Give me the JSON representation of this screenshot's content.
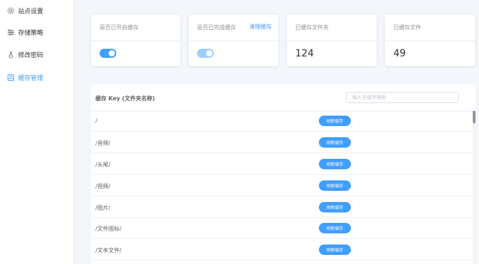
{
  "sidebar": {
    "items": [
      {
        "label": "站点设置",
        "icon": "gear-icon",
        "active": false
      },
      {
        "label": "存储策略",
        "icon": "sliders-icon",
        "active": false
      },
      {
        "label": "修改密码",
        "icon": "key-icon",
        "active": false
      },
      {
        "label": "缓存管理",
        "icon": "cache-icon",
        "active": true
      }
    ]
  },
  "cards": {
    "cache_enabled": {
      "title": "是否已开启缓存",
      "switch_on": true
    },
    "cache_completed": {
      "title": "是否已完成缓存",
      "link": "清理缓存",
      "switch_on": true
    },
    "cached_folders": {
      "title": "已缓存文件夹",
      "value": "124"
    },
    "cached_files": {
      "title": "已缓存文件",
      "value": "49"
    }
  },
  "table": {
    "column_label": "缓存 Key (文件夹名称)",
    "search_placeholder": "输入关键字搜索",
    "rows": [
      {
        "key": "/",
        "action": "刷新缓存"
      },
      {
        "key": "/音频/",
        "action": "刷新缓存"
      },
      {
        "key": "/头尾/",
        "action": "刷新缓存"
      },
      {
        "key": "/视频/",
        "action": "刷新缓存"
      },
      {
        "key": "/图片/",
        "action": "刷新缓存"
      },
      {
        "key": "/文件图标/",
        "action": "刷新缓存"
      },
      {
        "key": "/文本文件/",
        "action": "刷新缓存"
      }
    ]
  },
  "colors": {
    "accent": "#409eff",
    "accent_disabled": "#9fcbff",
    "background": "#f3f6fa"
  }
}
